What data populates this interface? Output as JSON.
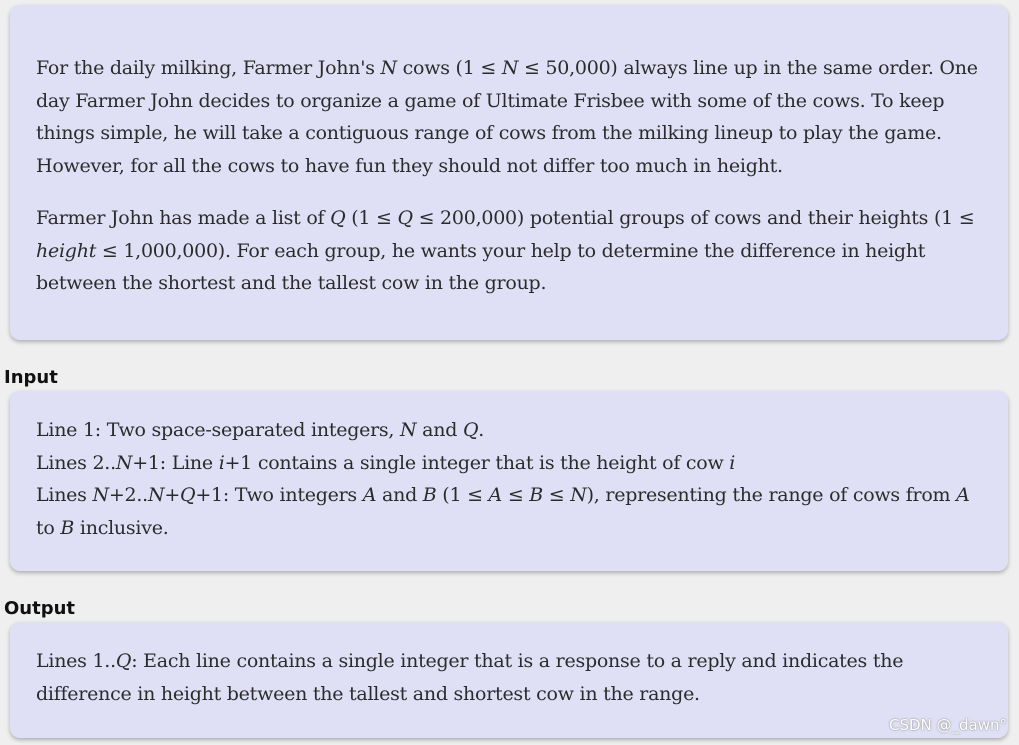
{
  "description": {
    "p1": [
      "For the daily milking, Farmer John's ",
      "N",
      " cows (1 ≤ ",
      "N",
      " ≤ 50,000) always line up in the same order. One day Farmer John decides to organize a game of Ultimate Frisbee with some of the cows. To keep things simple, he will take a contiguous range of cows from the milking lineup to play the game. However, for all the cows to have fun they should not differ too much in height."
    ],
    "p2": [
      "Farmer John has made a list of ",
      "Q",
      " (1 ≤ ",
      "Q",
      " ≤ 200,000) potential groups of cows and their heights (1 ≤ ",
      "height",
      " ≤ 1,000,000). For each group, he wants your help to determine the difference in height between the shortest and the tallest cow in the group."
    ]
  },
  "input": {
    "heading": "Input",
    "line1": [
      "Line 1: Two space-separated integers, ",
      "N",
      " and ",
      "Q",
      "."
    ],
    "line2": [
      "Lines 2..",
      "N",
      "+1: Line ",
      "i",
      "+1 contains a single integer that is the height of cow ",
      "i"
    ],
    "line3": [
      "Lines ",
      "N",
      "+2..",
      "N",
      "+",
      "Q",
      "+1: Two integers ",
      "A",
      " and ",
      "B",
      " (1 ≤ ",
      "A",
      " ≤ ",
      "B",
      " ≤ ",
      "N",
      "), representing the range of cows from ",
      "A",
      " to ",
      "B",
      " inclusive."
    ]
  },
  "output": {
    "heading": "Output",
    "line1": [
      "Lines 1..",
      "Q",
      ": Each line contains a single integer that is a response to a reply and indicates the difference in height between the tallest and shortest cow in the range."
    ]
  },
  "watermark": "CSDN @_dawn°",
  "colors": {
    "panel_bg": "#dfe0f5",
    "page_bg": "#efefef",
    "text": "#2b2b2b"
  }
}
